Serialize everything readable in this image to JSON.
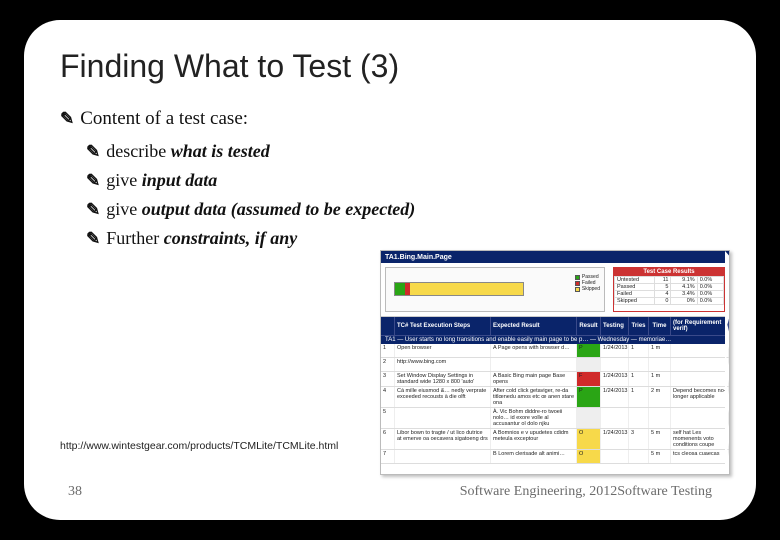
{
  "title": "Finding What to Test (3)",
  "bullets": {
    "main": "Content of a test case:",
    "items": [
      {
        "pre": "describe ",
        "em": "what is tested"
      },
      {
        "pre": "give ",
        "em": "input data"
      },
      {
        "pre": "give ",
        "em": "output data (assumed to be expected)"
      },
      {
        "pre": "Further ",
        "em": "constraints, if any"
      }
    ]
  },
  "citation": "http://www.wintestgear.com/products/TCMLite/TCMLite.html",
  "page_number": "38",
  "footer": "Software Engineering,  2012Software Testing",
  "app": {
    "title": "TA1.Bing.Main.Page",
    "stats_header": "Test Case Results",
    "stats": [
      {
        "label": "Untested",
        "n": "11",
        "pct": "9.1%",
        "overall": "0.0%"
      },
      {
        "label": "Passed",
        "n": "5",
        "pct": "4.1%",
        "overall": "0.0%"
      },
      {
        "label": "Failed",
        "n": "4",
        "pct": "3.4%",
        "overall": "0.0%"
      },
      {
        "label": "Skipped",
        "n": "0",
        "pct": "0%",
        "overall": "0.0%"
      }
    ],
    "legend": [
      {
        "label": "Passed",
        "color": "#2aa515"
      },
      {
        "label": "Failed",
        "color": "#d02a2a"
      },
      {
        "label": "Skipped",
        "color": "#f7d94a"
      }
    ],
    "columns": [
      "",
      "TC# Test Execution Steps",
      "Expected Result",
      "Result",
      "Testing",
      "Tries",
      "Time",
      "(for Requirement verif)"
    ],
    "subheader": "TA1 —  User starts no long transitions and enable easily main page to be p… — Wednesday — memoriae…",
    "rows": [
      {
        "n": "1",
        "step": "Open browser",
        "exp": "A Page opens with browser d…",
        "res": "P",
        "test": "1/24/2013",
        "tries": "1",
        "time": "1 m",
        "req": ""
      },
      {
        "n": "2",
        "step": "http://www.bing.com",
        "exp": "",
        "res": "",
        "test": "",
        "tries": "",
        "time": "",
        "req": ""
      },
      {
        "n": "3",
        "step": "Set Window Display Settings in standard wide 1280 x 800 'auto'",
        "exp": "A Basic Bing main page Base opens",
        "res": "F",
        "test": "1/24/2013",
        "tries": "1",
        "time": "1 m",
        "req": ""
      },
      {
        "n": "4",
        "step": "Cá mille eiusmod &… nedly verprate exceeded recousts à die olft",
        "exp": "After cold click getaviger, re-da titlœnedu amos etc œ anen stare ona",
        "res": "P",
        "test": "1/24/2013",
        "tries": "1",
        "time": "2 m",
        "req": "Depend becomes no-longer applicable"
      },
      {
        "n": "5",
        "step": "",
        "exp": "À. Vic Bohm diddre-ro twoeii nolo… id exore volle al accusantur ol dolo njku",
        "res": "",
        "test": "",
        "tries": "",
        "time": "",
        "req": ""
      },
      {
        "n": "6",
        "step": "Libor bown to tragte / ut lico dutrice at emerve oa oecavera sigatoeng drs",
        "exp": "A Bomnios e v upudetes cdidm meteula exceptour",
        "res": "O",
        "test": "1/24/2013",
        "tries": "3",
        "time": "5 m",
        "req": "self hat Les momenents voto conditions coupe"
      },
      {
        "n": "7",
        "step": "",
        "exp": "B Lorem clerisade alt animi…",
        "res": "O",
        "test": "",
        "tries": "",
        "time": "5 m",
        "req": "tcs cleosa cuaecas"
      }
    ]
  }
}
